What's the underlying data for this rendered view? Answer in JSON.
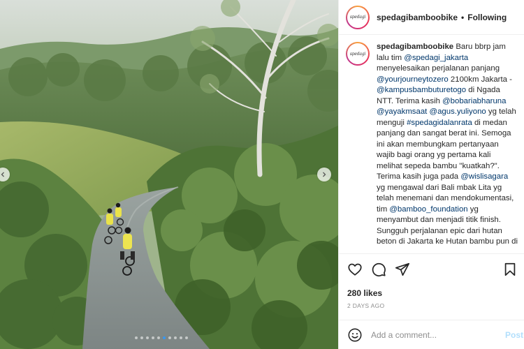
{
  "post": {
    "username": "spedagibamboobike",
    "avatar_text": "spedagi",
    "header_separator": "•",
    "follow_status": "Following",
    "caption": [
      {
        "t": "text",
        "v": "Baru bbrp jam lalu tim "
      },
      {
        "t": "link",
        "v": "@spedagi_jakarta"
      },
      {
        "t": "text",
        "v": " menyelesaikan perjalanan panjang "
      },
      {
        "t": "link",
        "v": "@yourjourneytozero"
      },
      {
        "t": "text",
        "v": " 2100km Jakarta - "
      },
      {
        "t": "link",
        "v": "@kampusbambuturetogo"
      },
      {
        "t": "text",
        "v": " di Ngada NTT. Terima kasih "
      },
      {
        "t": "link",
        "v": "@bobariabharuna"
      },
      {
        "t": "text",
        "v": " "
      },
      {
        "t": "link",
        "v": "@yayakmsaat"
      },
      {
        "t": "text",
        "v": " "
      },
      {
        "t": "link",
        "v": "@agus.yuliyono"
      },
      {
        "t": "text",
        "v": " yg telah menguji "
      },
      {
        "t": "link",
        "v": "#spedagidalanrata"
      },
      {
        "t": "text",
        "v": " di medan panjang dan sangat berat ini. Semoga ini akan membungkam pertanyaan wajib bagi orang yg pertama kali melihat sepeda bambu \"kuatkah?\". Terima kasih juga pada "
      },
      {
        "t": "link",
        "v": "@wislisagara"
      },
      {
        "t": "text",
        "v": " yg mengawal dari Bali mbak Lita yg telah menemani dan mendokumentasi, tim "
      },
      {
        "t": "link",
        "v": "@bamboo_foundation"
      },
      {
        "t": "text",
        "v": " yg menyambut dan menjadi titik finish. Sungguh perjalanan epic dari hutan beton di Jakarta ke Hutan bambu pun di"
      }
    ],
    "likes": "280 likes",
    "timestamp": "2 DAYS AGO",
    "carousel": {
      "count": 10,
      "active": 5
    }
  },
  "comment": {
    "placeholder": "Add a comment...",
    "post_label": "Post"
  },
  "icons": {
    "like": "heart-icon",
    "comment": "comment-icon",
    "share": "share-icon",
    "save": "bookmark-icon",
    "emoji": "emoji-icon",
    "prev": "chevron-left-icon",
    "next": "chevron-right-icon"
  },
  "colors": {
    "link": "#00376b",
    "post_button": "#b2dffc",
    "active_dot": "#3897f0",
    "muted": "#8e8e8e"
  }
}
